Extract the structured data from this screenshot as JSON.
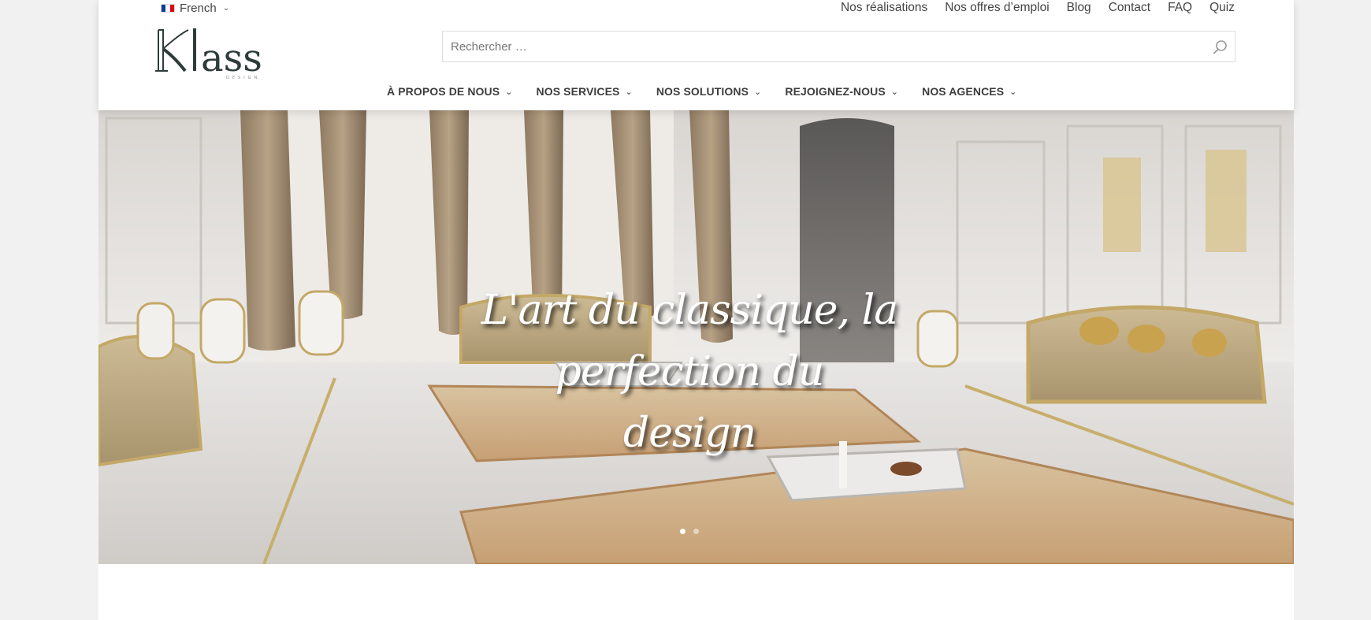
{
  "language": {
    "label": "French",
    "flag": [
      "#0a3a9e",
      "#ffffff",
      "#e1000f"
    ]
  },
  "topnav": [
    "Nos réalisations",
    "Nos offres d’emploi",
    "Blog",
    "Contact",
    "FAQ",
    "Quiz"
  ],
  "brand": {
    "name": "Klass",
    "tagline": "DESIGN"
  },
  "search": {
    "placeholder": "Rechercher …"
  },
  "mainnav": [
    "À PROPOS DE NOUS",
    "NOS SERVICES",
    "NOS SOLUTIONS",
    "REJOIGNEZ-NOUS",
    "NOS AGENCES"
  ],
  "hero": {
    "title_line1": "L'art du classique, la perfection du",
    "title_line2": "design",
    "slides": 2,
    "active_slide": 0
  },
  "colors": {
    "accent": "#c9a24f",
    "text": "#3d3d3d",
    "logo": "#2f3b3b"
  }
}
